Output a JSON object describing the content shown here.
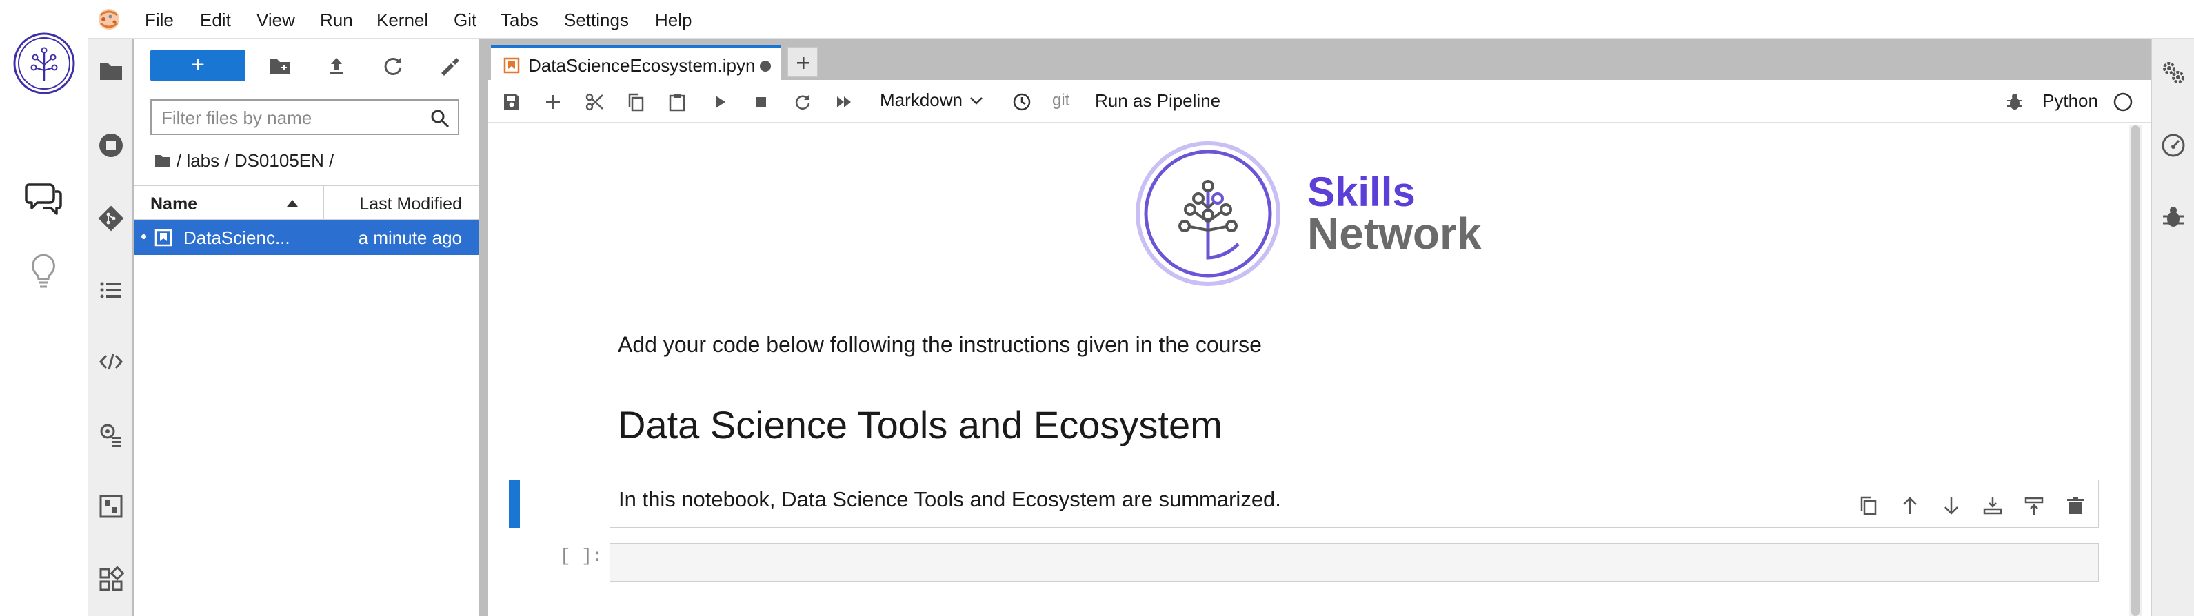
{
  "menu": {
    "items": [
      "File",
      "Edit",
      "View",
      "Run",
      "Kernel",
      "Git",
      "Tabs",
      "Settings",
      "Help"
    ]
  },
  "left_rail": {
    "icons": [
      "skills-network-logo",
      "chat-icon",
      "lightbulb-icon"
    ]
  },
  "activity_bar": {
    "icons": [
      "folder-icon",
      "running-icon",
      "git-icon",
      "toc-icon",
      "code-snippet-icon",
      "settings-list-icon",
      "extension-icon",
      "puzzle-icon"
    ]
  },
  "file_browser": {
    "new_button_label": "+",
    "filter_placeholder": "Filter files by name",
    "breadcrumb": "/ labs / DS0105EN /",
    "columns": {
      "name": "Name",
      "modified": "Last Modified"
    },
    "files": [
      {
        "dot": "•",
        "name": "DataScienc...",
        "modified": "a minute ago"
      }
    ]
  },
  "tab": {
    "label": "DataScienceEcosystem.ipyn",
    "new_tab": "+"
  },
  "toolbar": {
    "cell_type": "Markdown",
    "git_label": "git",
    "pipeline_label": "Run as Pipeline",
    "kernel_name": "Python"
  },
  "notebook": {
    "logo_skills": "Skills",
    "logo_network": "Network",
    "intro_text": "Add your code below following the instructions given in the course",
    "title": "Data Science Tools and Ecosystem",
    "active_cell_text": "In this notebook, Data Science Tools and Ecosystem are summarized.",
    "code_prompt": "[ ]:"
  },
  "colors": {
    "accent": "#1976d2",
    "selected_row": "#2b6fd0",
    "brand_purple": "#5b3fd6",
    "brand_gray": "#6b6b6b"
  }
}
